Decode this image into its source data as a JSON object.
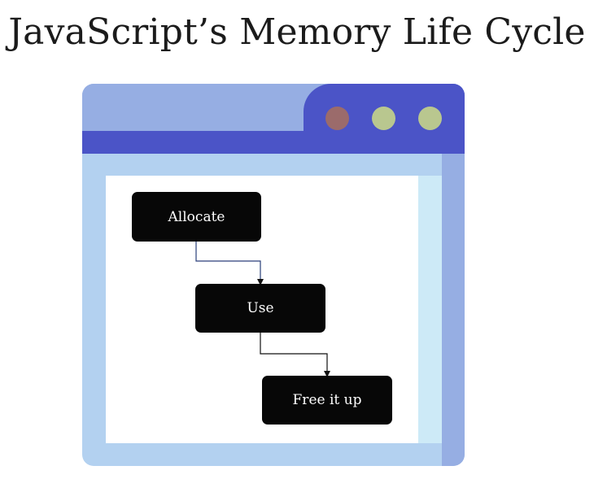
{
  "title": "JavaScript’s Memory Life Cycle",
  "diagram": {
    "nodes": [
      {
        "id": "allocate",
        "label": "Allocate"
      },
      {
        "id": "use",
        "label": "Use"
      },
      {
        "id": "free",
        "label": "Free it up"
      }
    ],
    "edges": [
      {
        "from": "allocate",
        "to": "use"
      },
      {
        "from": "use",
        "to": "free"
      }
    ]
  },
  "colors": {
    "window_body": "#b3d1f0",
    "titlebar_light": "#96aee3",
    "titlebar_dark": "#4b54c7",
    "dot_red": "#9b6b6b",
    "dot_olive": "#b9c78f",
    "node_fill": "#070707",
    "node_text": "#ffffff"
  }
}
